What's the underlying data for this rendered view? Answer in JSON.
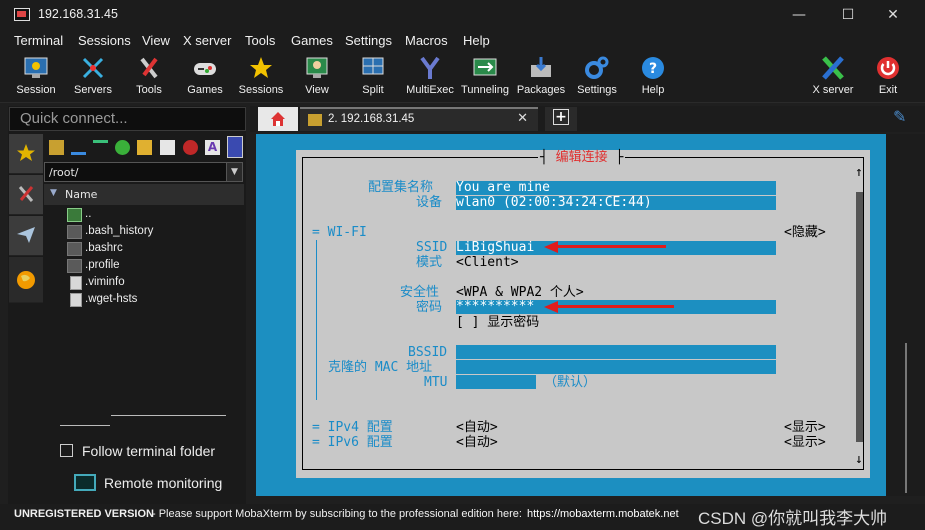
{
  "window": {
    "title": "192.168.31.45",
    "minimize": "—",
    "maximize": "☐",
    "close": "✕"
  },
  "menu": [
    "Terminal",
    "Sessions",
    "View",
    "X server",
    "Tools",
    "Games",
    "Settings",
    "Macros",
    "Help"
  ],
  "toolbar": [
    {
      "label": "Session",
      "icon": "session-icon"
    },
    {
      "label": "Servers",
      "icon": "servers-icon"
    },
    {
      "label": "Tools",
      "icon": "tools-icon"
    },
    {
      "label": "Games",
      "icon": "games-icon"
    },
    {
      "label": "Sessions",
      "icon": "star-icon"
    },
    {
      "label": "View",
      "icon": "view-icon"
    },
    {
      "label": "Split",
      "icon": "split-icon"
    },
    {
      "label": "MultiExec",
      "icon": "multiexec-icon"
    },
    {
      "label": "Tunneling",
      "icon": "tunneling-icon"
    },
    {
      "label": "Packages",
      "icon": "packages-icon"
    },
    {
      "label": "Settings",
      "icon": "gears-icon"
    },
    {
      "label": "Help",
      "icon": "help-icon"
    },
    {
      "label": "X server",
      "icon": "xserver-icon"
    },
    {
      "label": "Exit",
      "icon": "power-icon"
    }
  ],
  "sidebar": {
    "quick_placeholder": "Quick connect...",
    "path": "/root/",
    "column_name": "Name",
    "files": [
      {
        "name": "..",
        "type": "up"
      },
      {
        "name": ".bash_history",
        "type": "folder"
      },
      {
        "name": ".bashrc",
        "type": "folder"
      },
      {
        "name": ".profile",
        "type": "folder"
      },
      {
        "name": ".viminfo",
        "type": "doc"
      },
      {
        "name": ".wget-hsts",
        "type": "doc"
      }
    ],
    "follow_label": "Follow terminal folder",
    "remote_label": "Remote monitoring"
  },
  "tabs": {
    "session_title": "2. 192.168.31.45",
    "close": "✕"
  },
  "dialog": {
    "title": "编辑连接",
    "profile_label": "配置集名称",
    "profile_value": "You are mine",
    "device_label": "设备",
    "device_value": "wlan0 (02:00:34:24:CE:44)",
    "wifi_label": "= WI-FI",
    "wifi_hide": "<隐藏>",
    "ssid_label": "SSID",
    "ssid_value": "LiBigShuai",
    "mode_label": "模式",
    "mode_value": "<Client>",
    "security_label": "安全性",
    "security_value": "<WPA & WPA2 个人>",
    "password_label": "密码",
    "password_value": "**********",
    "show_password": "[ ] 显示密码",
    "bssid_label": "BSSID",
    "mac_label": "克隆的 MAC 地址",
    "mtu_label": "MTU",
    "mtu_default": "（默认）",
    "ipv4_label": "= IPv4 配置",
    "ipv4_value": "<自动>",
    "ipv4_show": "<显示>",
    "ipv6_label": "= IPv6 配置",
    "ipv6_value": "<自动>",
    "ipv6_show": "<显示>",
    "scroll_up": "↑",
    "scroll_down": "↓"
  },
  "status": {
    "unregistered": "UNREGISTERED VERSION",
    "message": "-  Please support MobaXterm by subscribing to the professional edition here:",
    "link": "https://mobaxterm.mobatek.net",
    "watermark": "CSDN @你就叫我李大帅"
  },
  "colors": {
    "terminal_bg": "#1c8fc1",
    "dialog_bg": "#c8c8c8",
    "annotation_arrow": "#e01c1c"
  }
}
